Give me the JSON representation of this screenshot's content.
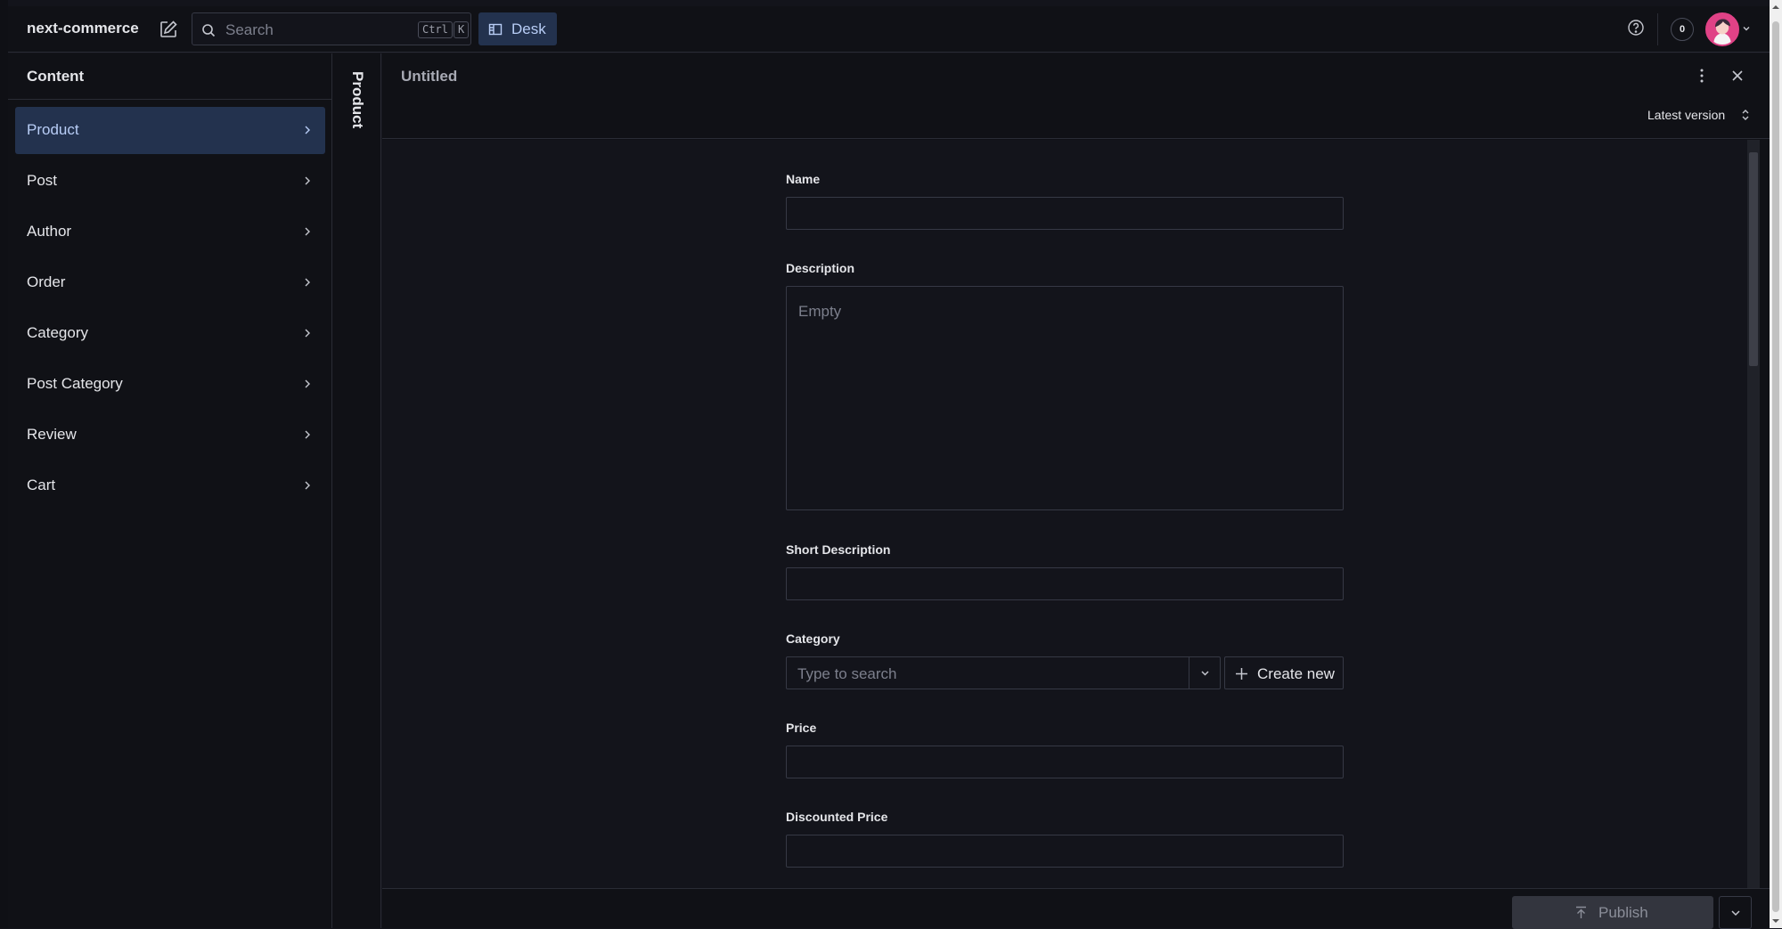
{
  "app": {
    "title": "next-commerce",
    "search_placeholder": "Search",
    "search_shortcut_ctrl": "Ctrl",
    "search_shortcut_key": "K",
    "desk_label": "Desk",
    "notification_count": "0"
  },
  "sidebar": {
    "title": "Content",
    "items": [
      {
        "label": "Product",
        "active": true
      },
      {
        "label": "Post"
      },
      {
        "label": "Author"
      },
      {
        "label": "Order"
      },
      {
        "label": "Category"
      },
      {
        "label": "Post Category"
      },
      {
        "label": "Review"
      },
      {
        "label": "Cart"
      }
    ]
  },
  "collapsed_pane": {
    "title": "Product"
  },
  "document": {
    "title": "Untitled",
    "version_label": "Latest version",
    "fields": {
      "name": {
        "label": "Name",
        "value": ""
      },
      "description": {
        "label": "Description",
        "placeholder": "Empty"
      },
      "short_description": {
        "label": "Short Description",
        "value": ""
      },
      "category": {
        "label": "Category",
        "placeholder": "Type to search",
        "create_label": "Create new"
      },
      "price": {
        "label": "Price",
        "value": ""
      },
      "discounted_price": {
        "label": "Discounted Price",
        "value": ""
      }
    },
    "publish_label": "Publish"
  },
  "colors": {
    "background": "#13141b",
    "accent": "#23324e",
    "accent_text": "#b8cdf6",
    "avatar": "#e04286"
  }
}
